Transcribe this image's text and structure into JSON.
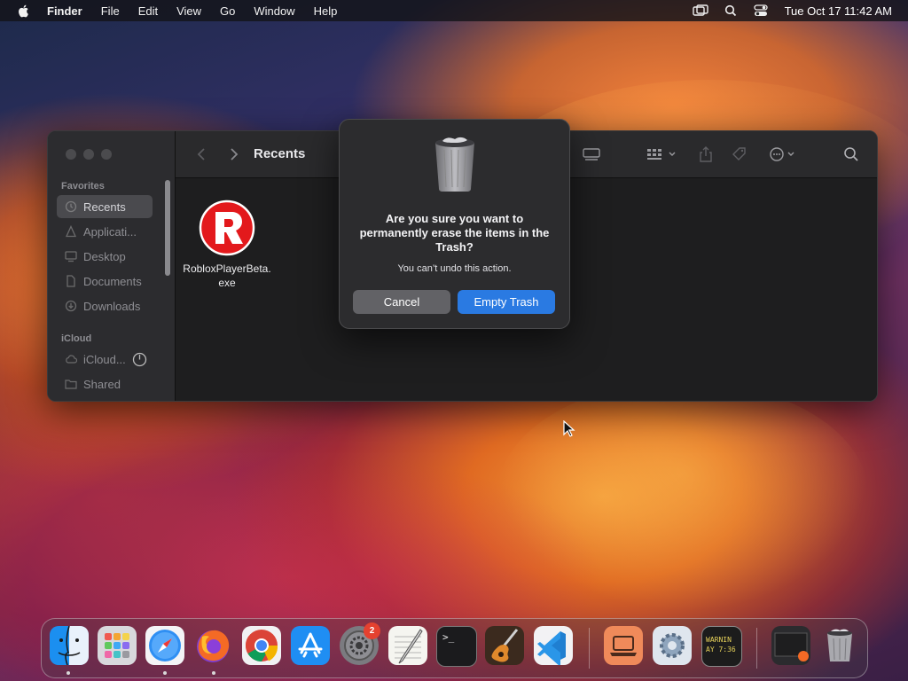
{
  "menubar": {
    "app_name": "Finder",
    "items": [
      "File",
      "Edit",
      "View",
      "Go",
      "Window",
      "Help"
    ],
    "clock": "Tue Oct 17  11:42 AM"
  },
  "finder": {
    "title": "Recents",
    "sidebar": {
      "favorites_label": "Favorites",
      "favorites": [
        "Recents",
        "Applicati...",
        "Desktop",
        "Documents",
        "Downloads"
      ],
      "icloud_label": "iCloud",
      "icloud": [
        "iCloud...",
        "Shared"
      ]
    },
    "files": [
      {
        "name_line1": "RobloxPlayerBeta.",
        "name_line2": "exe"
      }
    ]
  },
  "dialog": {
    "title": "Are you sure you want to permanently erase the items in the Trash?",
    "message": "You can’t undo this action.",
    "cancel_label": "Cancel",
    "confirm_label": "Empty Trash",
    "accent_color": "#2a7ae2"
  },
  "dock": {
    "apps": [
      "Finder",
      "Launchpad",
      "Safari",
      "Firefox",
      "Chrome",
      "App Store",
      "System Settings",
      "TextEdit",
      "Terminal",
      "GarageBand",
      "Visual Studio Code",
      "Remote Desktop",
      "Utility",
      "Console",
      "Recent Window",
      "Trash"
    ],
    "system_settings_badge": "2",
    "terminal_prompt": ">_",
    "console_lines": [
      "WARNIN",
      "AY 7:36"
    ]
  }
}
